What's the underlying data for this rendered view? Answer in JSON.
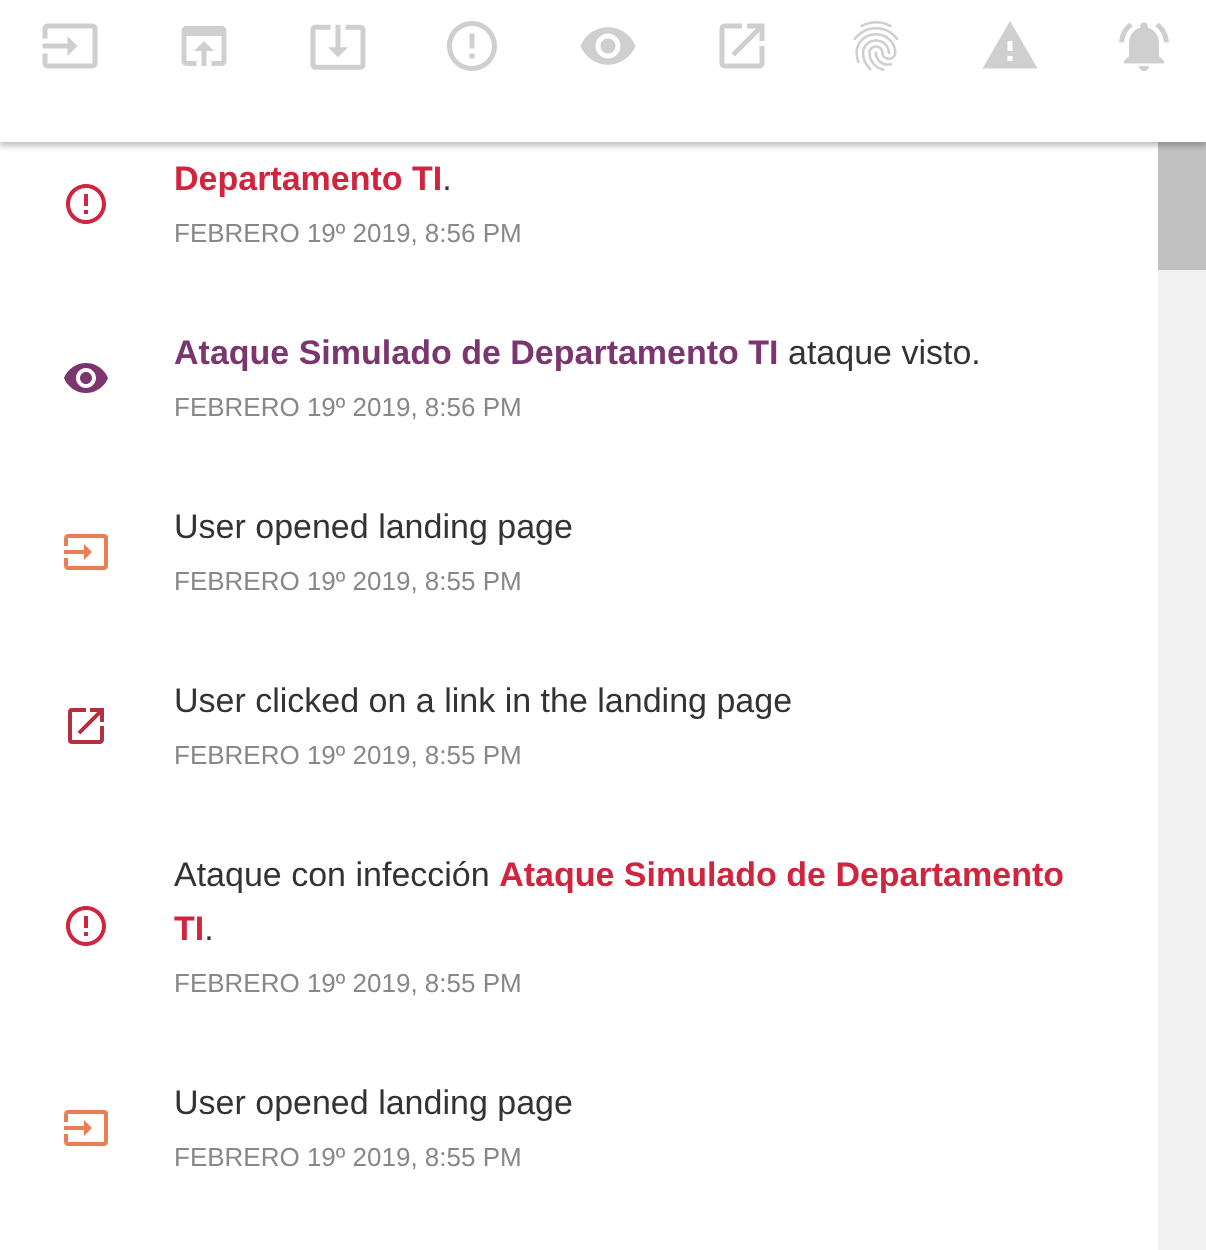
{
  "toolbar": {
    "icons": [
      {
        "kind": "input"
      },
      {
        "kind": "upload"
      },
      {
        "kind": "download"
      },
      {
        "kind": "alert"
      },
      {
        "kind": "eye"
      },
      {
        "kind": "external"
      },
      {
        "kind": "fingerprint"
      },
      {
        "kind": "warning"
      },
      {
        "kind": "bell"
      }
    ]
  },
  "events": [
    {
      "kind": "alert",
      "text": "**Departamento TI**.",
      "time": "FEBRERO 19º 2019, 8:56 PM"
    },
    {
      "kind": "viewed",
      "text": "**Ataque Simulado de Departamento TI** ataque visto.",
      "time": "FEBRERO 19º 2019, 8:56 PM"
    },
    {
      "kind": "opened",
      "text": "User opened landing page",
      "time": "FEBRERO 19º 2019, 8:55 PM"
    },
    {
      "kind": "clicked",
      "text": "User clicked on a link in the landing page",
      "time": "FEBRERO 19º 2019, 8:55 PM"
    },
    {
      "kind": "alert",
      "text": "Ataque con infección **Ataque Simulado de Departamento TI**.",
      "time": "FEBRERO 19º 2019, 8:55 PM"
    },
    {
      "kind": "opened",
      "text": "User opened landing page",
      "time": "FEBRERO 19º 2019, 8:55 PM"
    }
  ]
}
